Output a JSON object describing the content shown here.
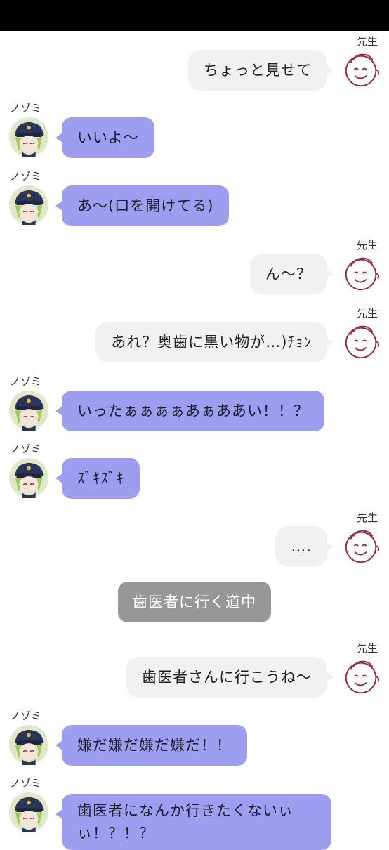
{
  "names": {
    "teacher": "先生",
    "nozomi": "ノゾミ"
  },
  "messages": [
    {
      "sender": "先生",
      "text": "ちょっと見せて"
    },
    {
      "sender": "ノゾミ",
      "text": "いいよ〜"
    },
    {
      "sender": "ノゾミ",
      "text": "あ〜(口を開けてる)"
    },
    {
      "sender": "先生",
      "text": "ん〜？"
    },
    {
      "sender": "先生",
      "text": "あれ？奥歯に黒い物が…)ﾁｮﾝ"
    },
    {
      "sender": "ノゾミ",
      "text": "いったぁぁぁぁあぁああい！！？"
    },
    {
      "sender": "ノゾミ",
      "text": "ｽﾞｷｽﾞｷ"
    },
    {
      "sender": "先生",
      "text": "…."
    },
    {
      "sender": "先生",
      "text": "歯医者さんに行こうね〜"
    },
    {
      "sender": "ノゾミ",
      "text": "嫌だ嫌だ嫌だ嫌だ！！"
    },
    {
      "sender": "ノゾミ",
      "text": "歯医者になんか行きたくないぃぃ！？！？"
    }
  ],
  "system_message": "歯医者に行く道中",
  "colors": {
    "incoming_bubble": "#9d9ef0",
    "outgoing_bubble": "#f1f1f1",
    "system_bubble": "#979797"
  },
  "icons": {
    "teacher_avatar": "doodle-face-icon",
    "nozomi_avatar": "nozomi-portrait-icon"
  }
}
